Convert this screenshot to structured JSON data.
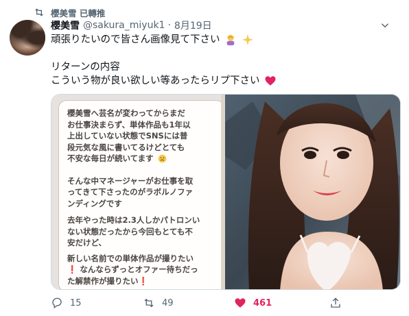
{
  "retweet_header": {
    "icon": "retweet-icon",
    "text": "櫻美雪 已轉推"
  },
  "tweet": {
    "display_name": "櫻美雪",
    "handle": "@sakura_miyuk1",
    "separator": "·",
    "date": "8月19日",
    "lines": {
      "l1": "頑張りたいので皆さん画像見て下さい",
      "l2": "リターンの内容",
      "l3": "こういう物が良い欲しい等あったらリプ下さい"
    }
  },
  "media": {
    "note_text": {
      "p1": "櫻美雪へ芸名が変わってからまだ",
      "p2": "お仕事決まらず、単体作品も1年以",
      "p3": "上出していない状態でSNSには普",
      "p4": "段元気な風に書いてるけどとても",
      "p5": "不安な毎日が続いてます",
      "p6": "そんな中マネージャーがお仕事を取",
      "p7": "ってきて下さったのがラボルノファ",
      "p8": "ンディングです",
      "p9": "去年やった時は2.3人しかパトロンい",
      "p10": "ない状態だったから今回もとても不",
      "p11": "安だけど、",
      "p12": "新しい名前での単体作品が撮りたい",
      "p13": "なんならずっとオファー待ちだっ",
      "p14": "た解禁作が撮りたい"
    }
  },
  "actions": {
    "reply_count": "15",
    "retweet_count": "49",
    "like_count": "461"
  },
  "colors": {
    "like": "#e0245e",
    "secondary_text": "#536471",
    "primary_text": "#0f1419"
  }
}
